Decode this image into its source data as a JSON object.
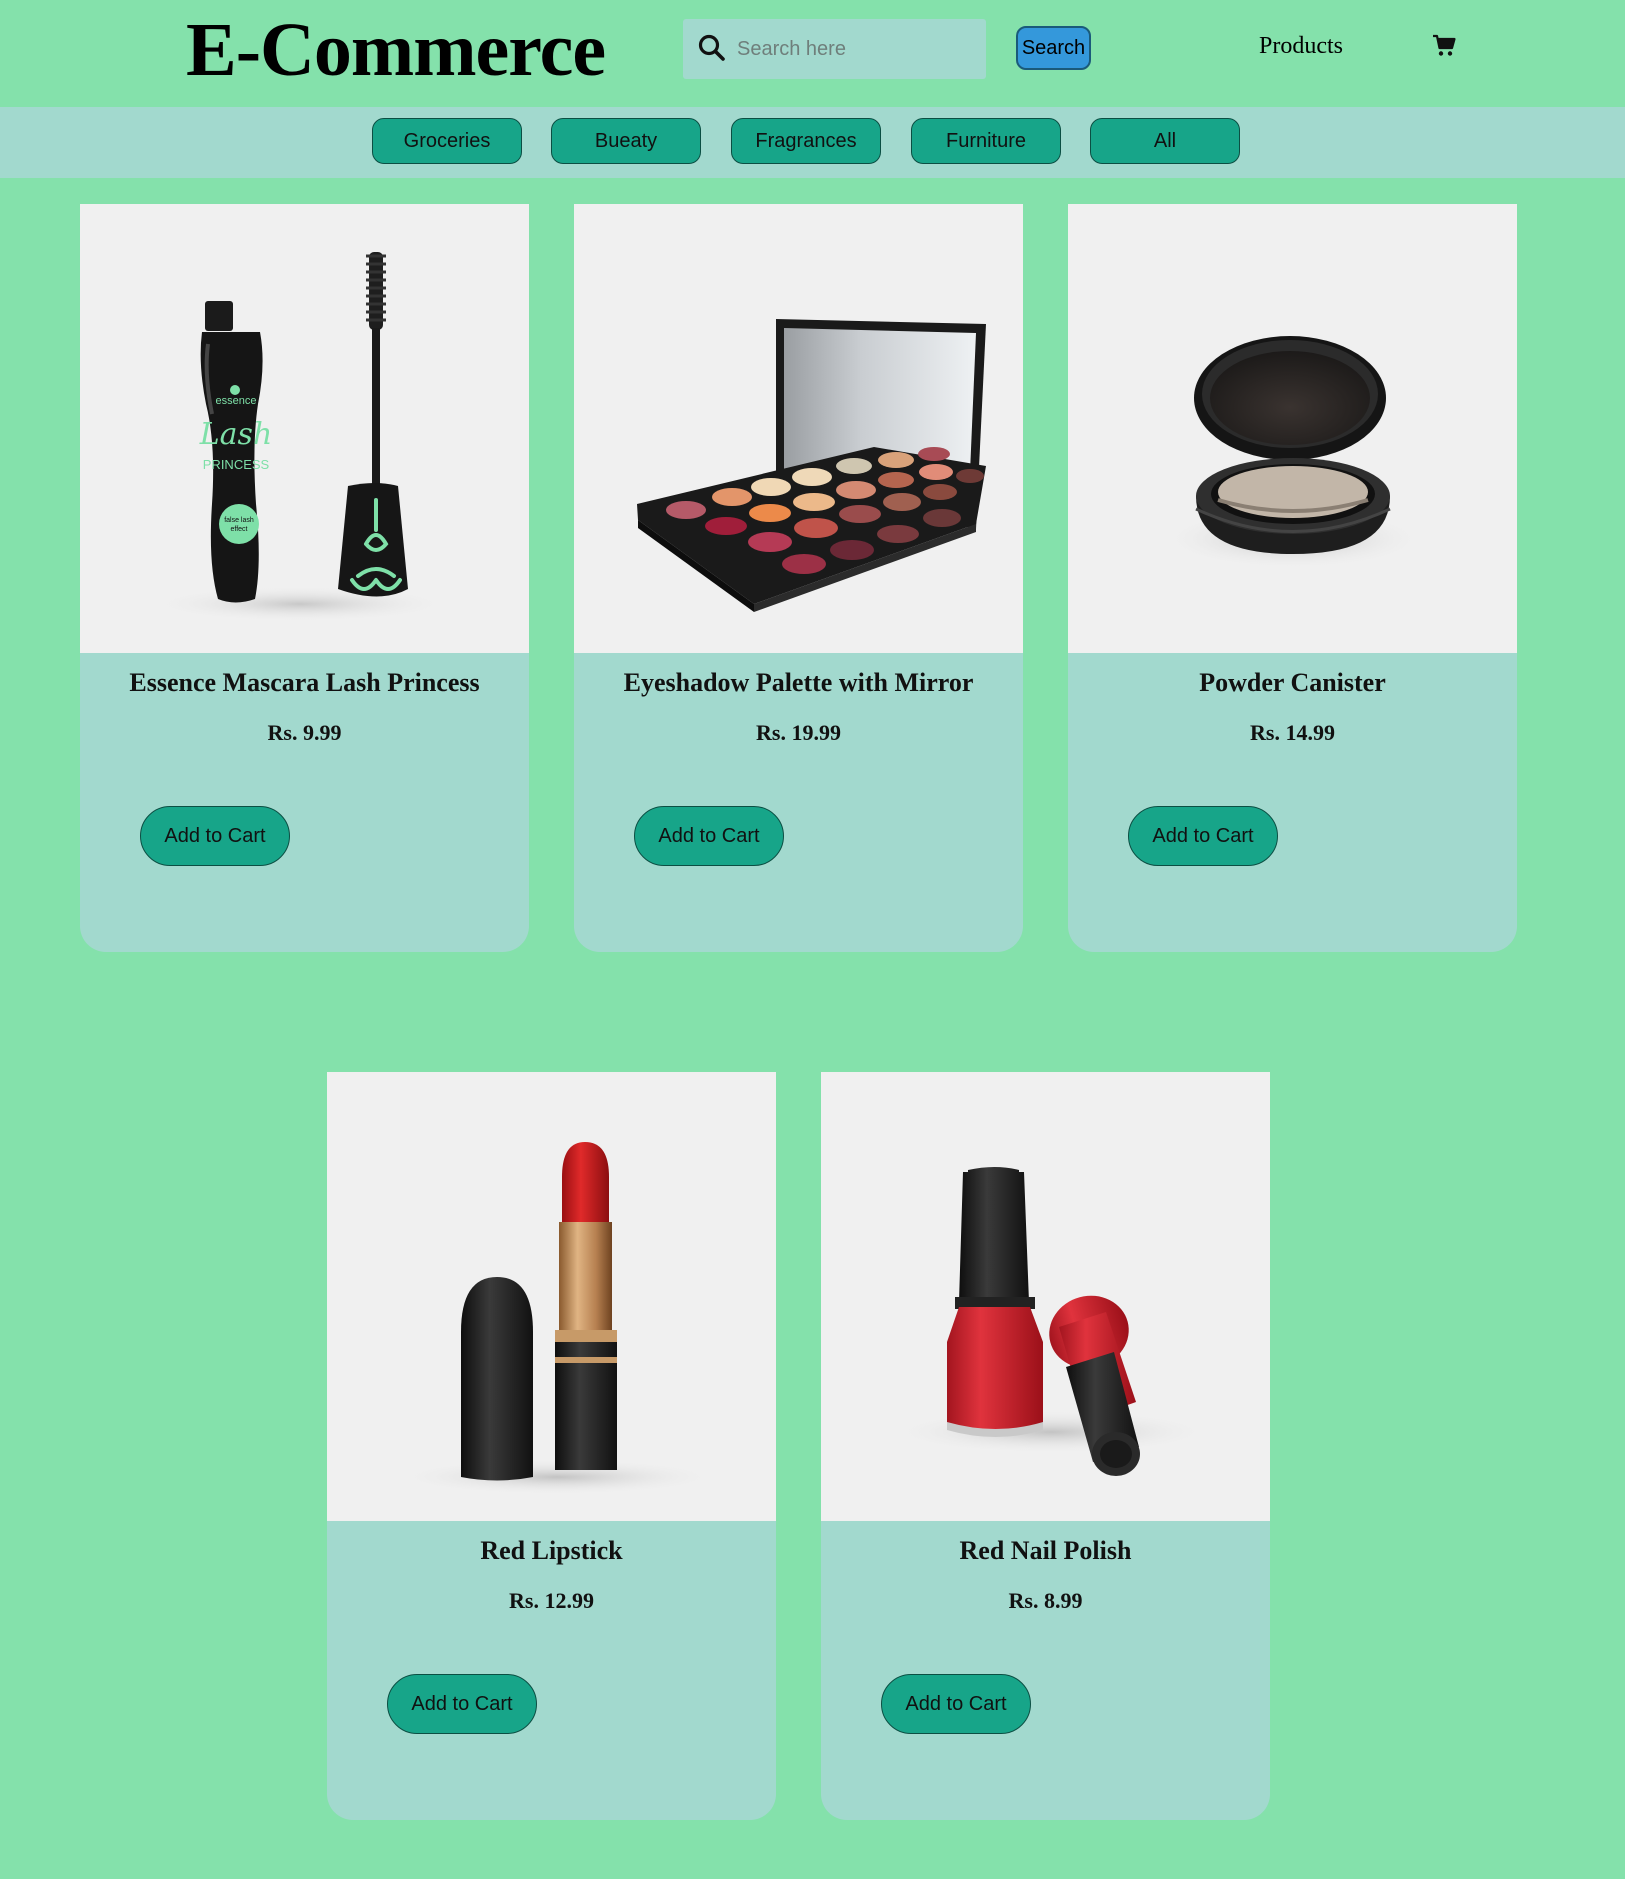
{
  "header": {
    "logo": "E-Commerce",
    "search_placeholder": "Search here",
    "search_button": "Search",
    "nav_products": "Products"
  },
  "categories": [
    "Groceries",
    "Bueaty",
    "Fragrances",
    "Furniture",
    "All"
  ],
  "products": [
    {
      "name": "Essence Mascara Lash Princess",
      "price": "Rs. 9.99",
      "button": "Add to Cart",
      "image_icon": "mascara-image",
      "image_text": "essence Lash PRINCESS false lash effect"
    },
    {
      "name": "Eyeshadow Palette with Mirror",
      "price": "Rs. 19.99",
      "button": "Add to Cart",
      "image_icon": "eyeshadow-palette-image"
    },
    {
      "name": "Powder Canister",
      "price": "Rs. 14.99",
      "button": "Add to Cart",
      "image_icon": "powder-compact-image"
    },
    {
      "name": "Red Lipstick",
      "price": "Rs. 12.99",
      "button": "Add to Cart",
      "image_icon": "lipstick-image"
    },
    {
      "name": "Red Nail Polish",
      "price": "Rs. 8.99",
      "button": "Add to Cart",
      "image_icon": "nail-polish-image"
    }
  ],
  "colors": {
    "page_background": "#84e1ab",
    "bar_background": "#a2d9ce",
    "button_teal": "#17a589",
    "search_button": "#3498db",
    "image_background": "#f0f0f0"
  }
}
